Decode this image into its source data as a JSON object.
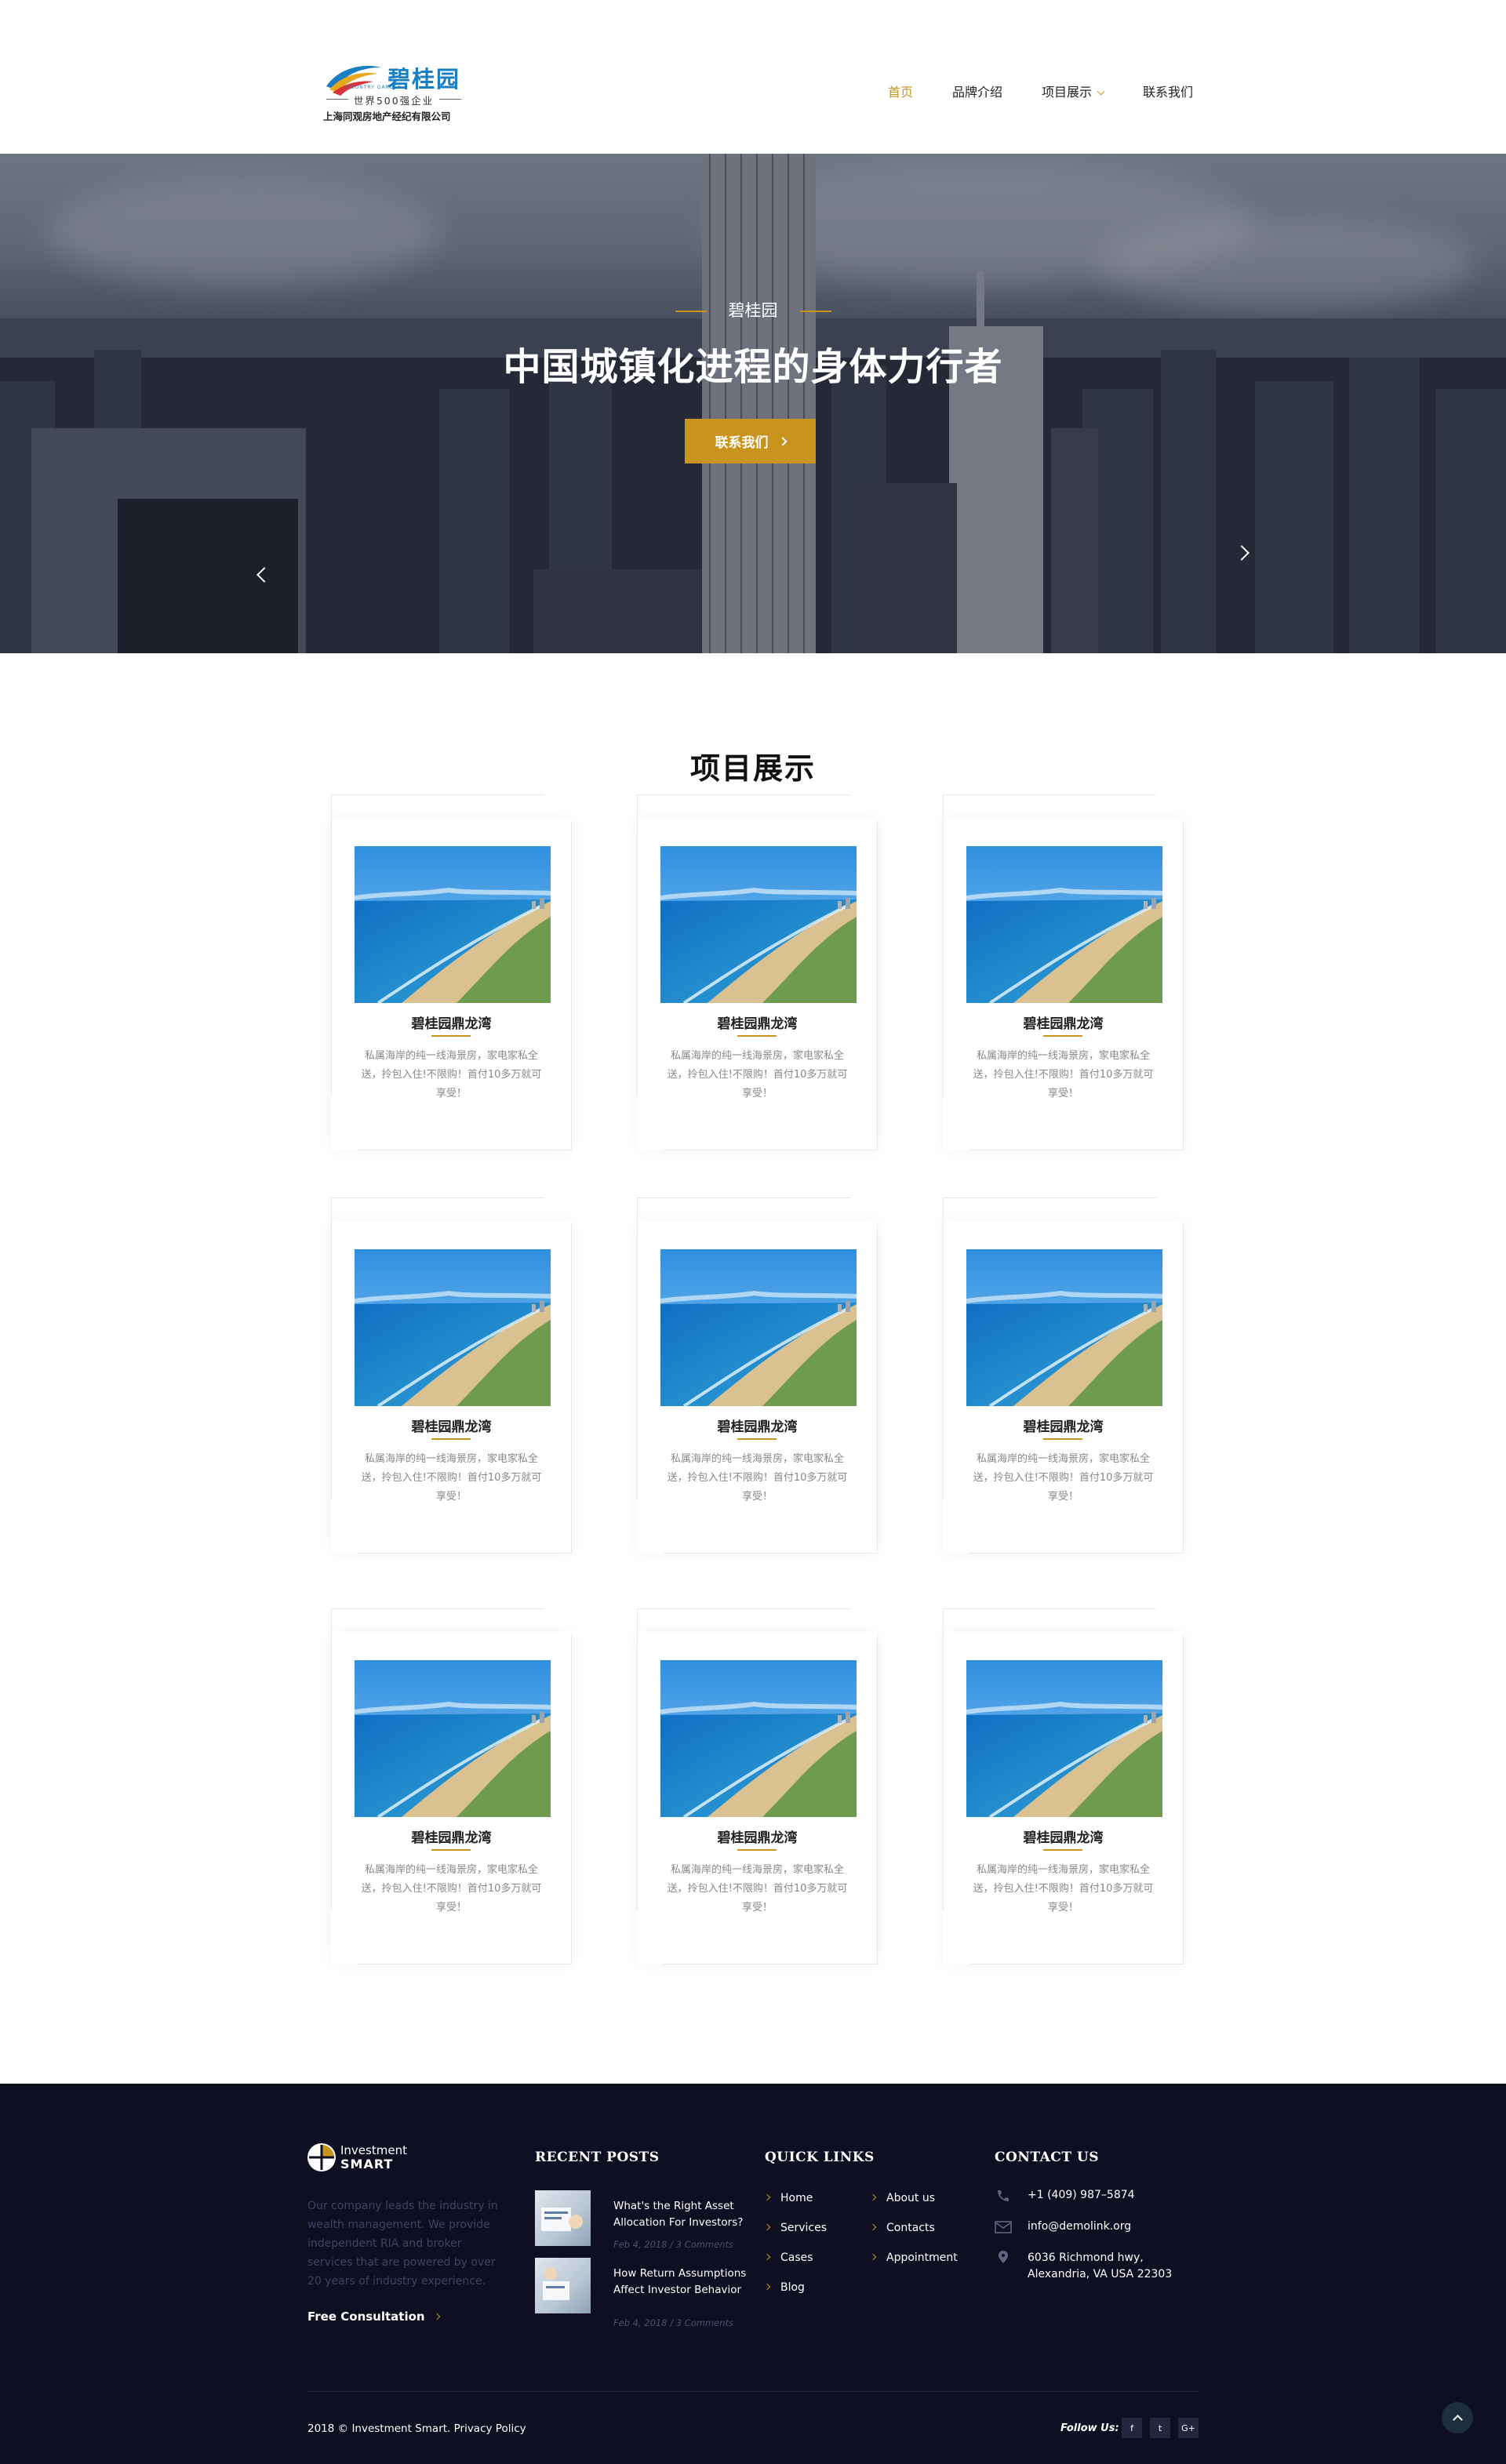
{
  "header": {
    "logo_cn": "碧桂园",
    "logo_en": "COUNTRY GARDEN",
    "logo_sub": "世界500强企业",
    "logo_company": "上海同观房地产经纪有限公司",
    "nav": [
      {
        "label": "首页"
      },
      {
        "label": "品牌介绍"
      },
      {
        "label": "项目展示"
      },
      {
        "label": "联系我们"
      }
    ]
  },
  "hero": {
    "tag": "碧桂园",
    "title": "中国城镇化进程的身体力行者",
    "button": "联系我们"
  },
  "projects": {
    "title": "项目展示",
    "cards": [
      {
        "name": "碧桂园鼎龙湾",
        "desc": "私属海岸的纯一线海景房，家电家私全送，拎包入住!不限购！首付10多万就可享受！"
      },
      {
        "name": "碧桂园鼎龙湾",
        "desc": "私属海岸的纯一线海景房，家电家私全送，拎包入住!不限购！首付10多万就可享受！"
      },
      {
        "name": "碧桂园鼎龙湾",
        "desc": "私属海岸的纯一线海景房，家电家私全送，拎包入住!不限购！首付10多万就可享受！"
      },
      {
        "name": "碧桂园鼎龙湾",
        "desc": "私属海岸的纯一线海景房，家电家私全送，拎包入住!不限购！首付10多万就可享受！"
      },
      {
        "name": "碧桂园鼎龙湾",
        "desc": "私属海岸的纯一线海景房，家电家私全送，拎包入住!不限购！首付10多万就可享受！"
      },
      {
        "name": "碧桂园鼎龙湾",
        "desc": "私属海岸的纯一线海景房，家电家私全送，拎包入住!不限购！首付10多万就可享受！"
      },
      {
        "name": "碧桂园鼎龙湾",
        "desc": "私属海岸的纯一线海景房，家电家私全送，拎包入住!不限购！首付10多万就可享受！"
      },
      {
        "name": "碧桂园鼎龙湾",
        "desc": "私属海岸的纯一线海景房，家电家私全送，拎包入住!不限购！首付10多万就可享受！"
      },
      {
        "name": "碧桂园鼎龙湾",
        "desc": "私属海岸的纯一线海景房，家电家私全送，拎包入住!不限购！首付10多万就可享受！"
      }
    ]
  },
  "footer": {
    "logo_line1": "Investment",
    "logo_line2": "SMART",
    "about": "Our company leads the industry in wealth management. We provide independent RIA and broker services that are powered by over 20 years of industry experience.",
    "consult": "Free Consultation",
    "recent_heading": "RECENT POSTS",
    "posts": [
      {
        "title": "What's the Right Asset Allocation For Investors?",
        "meta": "Feb 4, 2018 / 3 Comments"
      },
      {
        "title": "How Return Assumptions Affect Investor Behavior",
        "meta": "Feb 4, 2018 / 3 Comments"
      }
    ],
    "links_heading": "QUICK LINKS",
    "links": [
      "Home",
      "About us",
      "Services",
      "Contacts",
      "Cases",
      "Appointment",
      "Blog"
    ],
    "contact_heading": "CONTACT US",
    "phone": "+1 (409) 987–5874",
    "email": "info@demolink.org",
    "address": "6036 Richmond hwy, Alexandria, VA USA 22303",
    "copyright": "2018  ©  Investment Smart.  Privacy Policy",
    "follow": "Follow Us:",
    "social": [
      {
        "icon": "facebook-icon",
        "glyph": "f"
      },
      {
        "icon": "twitter-icon",
        "glyph": "t"
      },
      {
        "icon": "google-plus-icon",
        "glyph": "G+"
      }
    ]
  },
  "colors": {
    "accent": "#c8941e",
    "footer_bg": "#0e0f22",
    "logo_blue": "#1a7fc1"
  }
}
